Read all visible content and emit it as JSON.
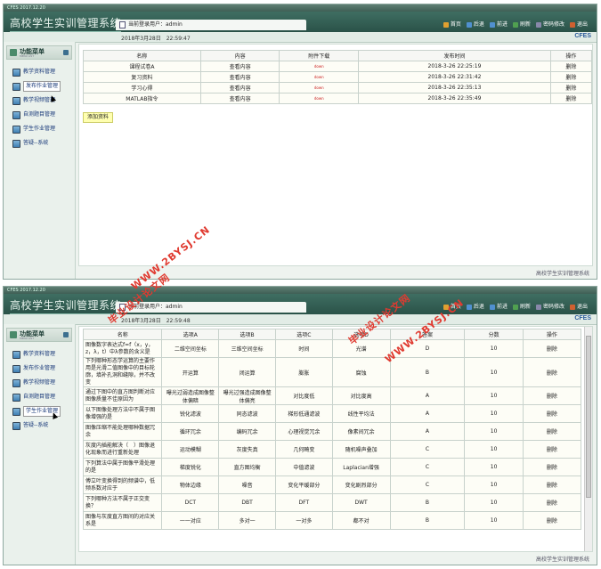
{
  "app_title": "高校学生实训管理系统",
  "window_caption": "CFES 2017.12.20",
  "user_label": "当前登录用户：admin",
  "toolbar": [
    {
      "label": "首页",
      "color": "#e0a030"
    },
    {
      "label": "后退",
      "color": "#5090d0"
    },
    {
      "label": "前进",
      "color": "#5090d0"
    },
    {
      "label": "刷新",
      "color": "#50a050"
    },
    {
      "label": "密码修改",
      "color": "#8888aa"
    },
    {
      "label": "退出",
      "color": "#d06030"
    }
  ],
  "brand": "CFES",
  "menu": {
    "title": "功能菜单",
    "subtitle": "MENU LIST",
    "items": [
      "教学资料管理",
      "发布作业管理",
      "教学视频管理",
      "自测题目管理",
      "学生作业管理",
      "答疑--系统"
    ]
  },
  "footer": "高校学生实训管理系统",
  "screen1": {
    "date": "2018年3月28日　22:59:47",
    "headers": [
      "名称",
      "内容",
      "附件下载",
      "发布时间",
      "操作"
    ],
    "rows": [
      {
        "name": "课程试卷A",
        "content": "查看内容",
        "download": "down",
        "time": "2018-3-26 22:25:19",
        "op": "删除"
      },
      {
        "name": "复习资料",
        "content": "查看内容",
        "download": "down",
        "time": "2018-3-26 22:31:42",
        "op": "删除"
      },
      {
        "name": "学习心得",
        "content": "查看内容",
        "download": "down",
        "time": "2018-3-26 22:35:13",
        "op": "删除"
      },
      {
        "name": "MATLAB指令",
        "content": "查看内容",
        "download": "down",
        "time": "2018-3-26 22:35:49",
        "op": "删除"
      }
    ],
    "add_button": "添加资料"
  },
  "screen2": {
    "date": "2018年3月28日　22:59:48",
    "headers": [
      "名称",
      "选项A",
      "选项B",
      "选项C",
      "选项D",
      "答案",
      "分数",
      "操作"
    ],
    "rows": [
      {
        "q": "图像数字表达式f=f（x，y，z，λ，t）中λ参数的含义是",
        "a": "二维空间坐标",
        "b": "三维空间坐标",
        "c": "时间",
        "d": "光谱",
        "ans": "D",
        "score": "10",
        "op": "删除"
      },
      {
        "q": "下列哪种形态学运算的主要作用是光滑二值图像中的目标轮廓，填补孔洞和缝隙，并不改变",
        "a": "开运算",
        "b": "闭运算",
        "c": "膨胀",
        "d": "腐蚀",
        "ans": "B",
        "score": "10",
        "op": "删除"
      },
      {
        "q": "通过下图中的直方图判断对应图像质量不佳原因为",
        "a": "曝光过弱造成图像整体偏暗",
        "b": "曝光过强造成图像整体偏亮",
        "c": "对比度低",
        "d": "对比度高",
        "ans": "A",
        "score": "10",
        "op": "删除"
      },
      {
        "q": "以下图像处理方法中不属于图像增强的是",
        "a": "锐化滤波",
        "b": "同态滤波",
        "c": "梯形低通滤波",
        "d": "线性平均法",
        "ans": "A",
        "score": "10",
        "op": "删除"
      },
      {
        "q": "图像压缩不能处理哪种数据冗余",
        "a": "循环冗余",
        "b": "编码冗余",
        "c": "心理视觉冗余",
        "d": "像素间冗余",
        "ans": "A",
        "score": "10",
        "op": "删除"
      },
      {
        "q": "灰度内插能解决（　）图像退化现象而进行重新处理",
        "a": "运动模糊",
        "b": "灰度失真",
        "c": "几何畸变",
        "d": "随机噪声叠加",
        "ans": "C",
        "score": "10",
        "op": "删除"
      },
      {
        "q": "下列算法中属于图像平滑处理的是",
        "a": "梯度锐化",
        "b": "直方图均衡",
        "c": "中值滤波",
        "d": "Laplacian增强",
        "ans": "C",
        "score": "10",
        "op": "删除"
      },
      {
        "q": "傅立叶变换得到的频谱中，低频系数对应于",
        "a": "物体边缘",
        "b": "噪音",
        "c": "变化平缓部分",
        "d": "变化剧烈部分",
        "ans": "C",
        "score": "10",
        "op": "删除"
      },
      {
        "q": "下列哪种方法不属于正交变换？",
        "a": "DCT",
        "b": "DBT",
        "c": "DFT",
        "d": "DWT",
        "ans": "B",
        "score": "10",
        "op": "删除"
      },
      {
        "q": "图像与灰度直方图间的对应关系是",
        "a": "一一对应",
        "b": "多对一",
        "c": "一对多",
        "d": "都不对",
        "ans": "B",
        "score": "10",
        "op": "删除"
      }
    ]
  },
  "watermarks": [
    "毕业设计论文网",
    "WWW.2BYSJ.CN"
  ]
}
